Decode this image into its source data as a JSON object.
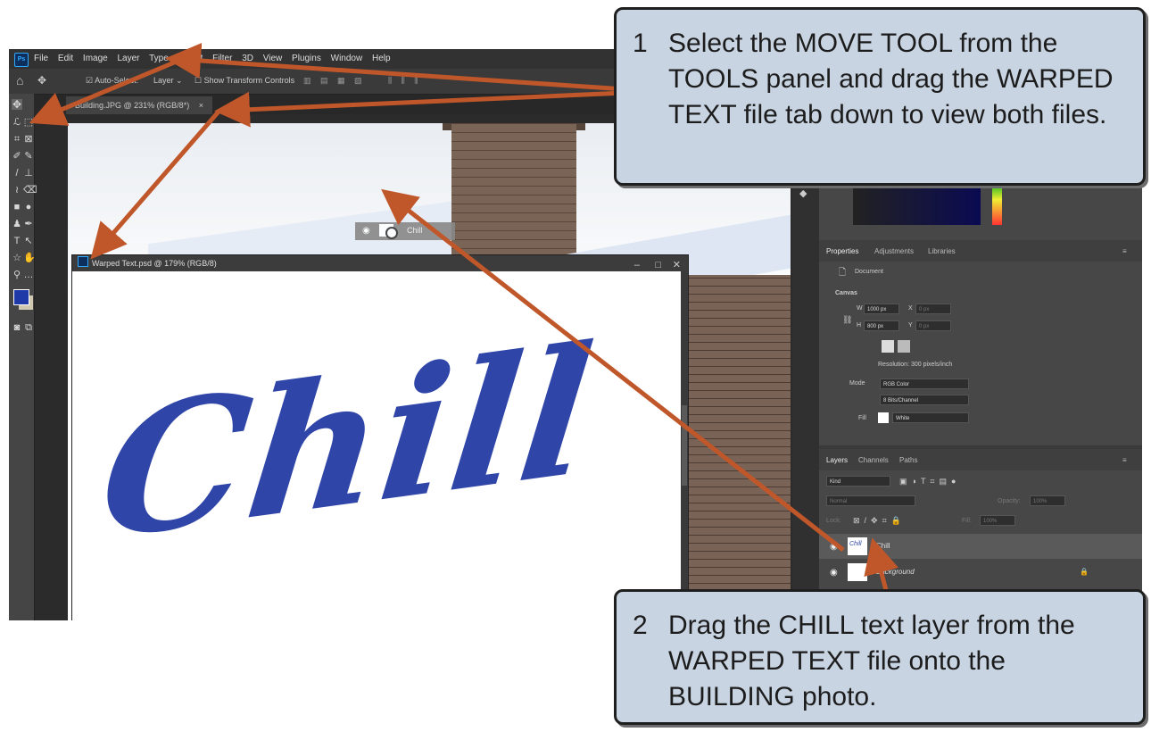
{
  "app": {
    "logo_text": "Ps",
    "menu": [
      "File",
      "Edit",
      "Image",
      "Layer",
      "Type",
      "Select",
      "Filter",
      "3D",
      "View",
      "Plugins",
      "Window",
      "Help"
    ]
  },
  "options_bar": {
    "auto_select": "Auto-Select:",
    "layer_dropdown": "Layer",
    "show_transform": "Show Transform Controls"
  },
  "document_tab": {
    "label": "Building.JPG @ 231% (RGB/8*)",
    "close": "×"
  },
  "drag_chip": {
    "label": "Chill"
  },
  "warped_window": {
    "title": "Warped Text.psd @ 179% (RGB/8)",
    "canvas_text": "Chill",
    "text_color": "#2f45a8"
  },
  "properties_panel": {
    "tabs": [
      "Properties",
      "Adjustments",
      "Libraries"
    ],
    "document_label": "Document",
    "section": "Canvas",
    "w_label": "W",
    "w_value": "1000 px",
    "x_label": "X",
    "x_value": "0 px",
    "h_label": "H",
    "h_value": "800 px",
    "y_label": "Y",
    "y_value": "0 px",
    "resolution": "Resolution: 300 pixels/inch",
    "mode_label": "Mode",
    "mode_value": "RGB Color",
    "bits_value": "8 Bits/Channel",
    "fill_label": "Fill",
    "fill_value": "White"
  },
  "layers_panel": {
    "tabs": [
      "Layers",
      "Channels",
      "Paths"
    ],
    "kind": "Kind",
    "blend_mode": "Normal",
    "opacity_label": "Opacity:",
    "opacity_value": "100%",
    "lock_label": "Lock:",
    "fill_label": "Fill:",
    "fill_value": "100%",
    "layers": [
      {
        "name": "Chill",
        "thumb_text": "Chill"
      },
      {
        "name": "Background"
      }
    ]
  },
  "callouts": [
    {
      "number": "1",
      "text": "Select the MOVE TOOL from the TOOLS panel and drag the WARPED TEXT file tab down to view both files."
    },
    {
      "number": "2",
      "text": "Drag the CHILL text layer from the WARPED TEXT file onto the BUILDING photo."
    }
  ],
  "colors": {
    "arrow": "#c0572a",
    "callout_bg": "#c8d4e2",
    "foreground_swatch": "#1f3aa8",
    "background_swatch": "#cfc7b0"
  }
}
